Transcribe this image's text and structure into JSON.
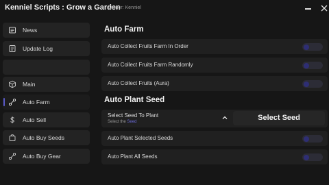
{
  "window": {
    "title": "Kenniel Scripts : Grow a Garden",
    "owner": "Owner: Kenniel"
  },
  "colors": {
    "accent": "#5a5ac8",
    "toggle_knob": "#2e2e74",
    "background": "#161616",
    "panel": "#202020"
  },
  "sidebar": {
    "items": [
      {
        "label": "News",
        "icon": "newspaper-icon"
      },
      {
        "label": "Update Log",
        "icon": "log-icon"
      },
      {
        "label": "",
        "icon": ""
      },
      {
        "label": "Main",
        "icon": "box-icon"
      },
      {
        "label": "Auto Farm",
        "icon": "route-icon",
        "active": true
      },
      {
        "label": "Auto Sell",
        "icon": "dollar-icon"
      },
      {
        "label": "Auto Buy Seeds",
        "icon": "shopping-bag-icon"
      },
      {
        "label": "Auto Buy Gear",
        "icon": "route-icon"
      }
    ]
  },
  "main": {
    "auto_farm": {
      "title": "Auto Farm",
      "toggles": [
        {
          "label": "Auto Collect Fruits Farm In Order",
          "on": false
        },
        {
          "label": "Auto Collect Fruits Farm Randomly",
          "on": false
        },
        {
          "label": "Auto Collect Fruits (Aura)",
          "on": false
        }
      ]
    },
    "auto_plant_seed": {
      "title": "Auto Plant Seed",
      "dropdown": {
        "label": "Select Seed To Plant",
        "sub_prefix": "Select the ",
        "sub_highlight": "Seed",
        "value": "Select Seed"
      },
      "toggles": [
        {
          "label": "Auto Plant Selected Seeds",
          "on": false
        },
        {
          "label": "Auto Plant All Seeds",
          "on": false
        }
      ]
    }
  }
}
